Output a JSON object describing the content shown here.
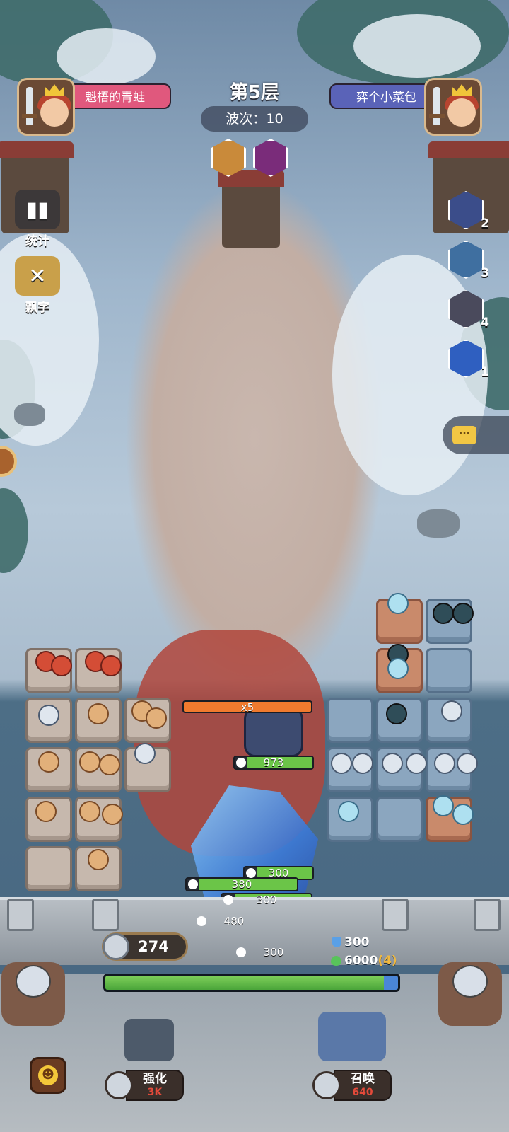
{
  "hud": {
    "player_left_name": "魁梧的青蛙",
    "player_right_name": "弈个小菜包",
    "floor_title": "第5层",
    "wave_label": "波次：",
    "wave_value": "10"
  },
  "side_menu": {
    "stats_label": "统计",
    "float_text_label": "飘字"
  },
  "skills": [
    {
      "icon": "hero-portrait-icon",
      "count": "2",
      "color": "#3b4d8a"
    },
    {
      "icon": "ice-beast-icon",
      "count": "3",
      "color": "#3f6fa0"
    },
    {
      "icon": "warrior-icon",
      "count": "4",
      "color": "#4a4a5c"
    },
    {
      "icon": "spiral-icon",
      "count": "1",
      "color": "#2f5fc0"
    }
  ],
  "battle": {
    "boss_multiplier": "x5",
    "boss_hp": "973",
    "hp_bars": [
      {
        "value": "300"
      },
      {
        "value": "380"
      },
      {
        "value": "300"
      },
      {
        "value": "480"
      },
      {
        "value": "300"
      }
    ]
  },
  "resources": {
    "coins": "274",
    "shield": "300",
    "health": "6000",
    "health_extra": "(4)",
    "base_hp_fraction": 0.97
  },
  "bottom_buttons": {
    "upgrade_label": "强化",
    "upgrade_cost": "3K",
    "summon_label": "召唤",
    "summon_cost": "640"
  },
  "colors": {
    "left_name_bg": "#e0587d",
    "right_name_bg": "#5a63b8",
    "accent_green": "#6bc548"
  }
}
